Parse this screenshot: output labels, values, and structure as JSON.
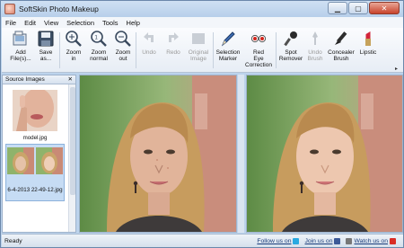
{
  "window": {
    "title": "SoftSkin Photo Makeup"
  },
  "menu": [
    "File",
    "Edit",
    "View",
    "Selection",
    "Tools",
    "Help"
  ],
  "toolbar": {
    "add_files": "Add\nFile(s)...",
    "save_as": "Save\nas...",
    "zoom_in": "Zoom\nin",
    "zoom_normal": "Zoom\nnormal",
    "zoom_out": "Zoom\nout",
    "undo": "Undo",
    "redo": "Redo",
    "original_image": "Original\nImage",
    "selection_marker": "Selection\nMarker",
    "red_eye": "Red\nEye\nCorrection",
    "spot_remover": "Spot\nRemover",
    "undo_brush": "Undo\nBrush",
    "concealer_brush": "Concealer\nBrush",
    "lipstick": "Lipstic"
  },
  "source_pane": {
    "title": "Source Images",
    "close_glyph": "✕",
    "items": [
      {
        "label": "model.jpg"
      },
      {
        "label": "6-4-2013 22-49-12.jpg"
      }
    ]
  },
  "statusbar": {
    "status": "Ready",
    "follow": "Follow us on",
    "join": "Join us on",
    "watch": "Watch us on"
  },
  "colors": {
    "accent": "#3b6fb6",
    "title_bar": "#bcd3ec"
  }
}
